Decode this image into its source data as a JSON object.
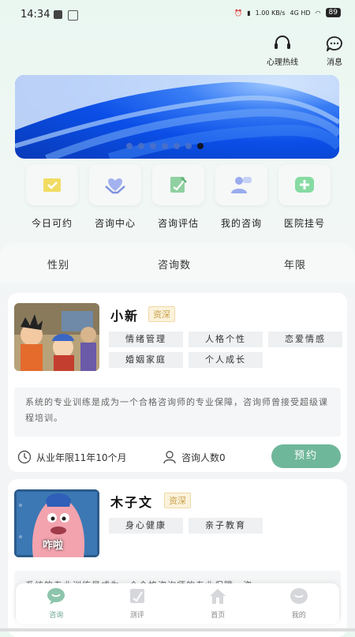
{
  "status": {
    "time": "14:34",
    "speed": "1.00\nKB/s",
    "network": "4G HD",
    "battery": "89"
  },
  "header": {
    "hotline_label": "心理热线",
    "message_label": "消息"
  },
  "banner": {
    "dots": 7,
    "active_dot": 6
  },
  "menu": [
    {
      "label": "今日可约",
      "icon": "calendar-check-icon",
      "color": "#e9d24a"
    },
    {
      "label": "咨询中心",
      "icon": "heart-hands-icon",
      "color": "#8fa2e6"
    },
    {
      "label": "咨询评估",
      "icon": "edit-doc-icon",
      "color": "#7cc58f"
    },
    {
      "label": "我的咨询",
      "icon": "user-chat-icon",
      "color": "#8fa2e6"
    },
    {
      "label": "医院挂号",
      "icon": "medical-cross-icon",
      "color": "#79d69a"
    }
  ],
  "filter": {
    "gender": "性别",
    "count": "咨询数",
    "years": "年限"
  },
  "counselors": [
    {
      "name": "小新",
      "badge": "资深",
      "tags": [
        "情绪管理",
        "人格个性",
        "恋爱情感",
        "婚姻家庭",
        "个人成长"
      ],
      "desc": "系统的专业训练是成为一个合格咨询师的专业保障，咨询师曾接受超级课程培训。",
      "experience": "从业年限11年10个月",
      "consult_count": "咨询人数0",
      "book_label": "预约"
    },
    {
      "name": "木子文",
      "badge": "资深",
      "tags": [
        "身心健康",
        "亲子教育"
      ],
      "desc": "系统的专业训练是成为一个合格咨询师的专业保障，咨",
      "avatar_caption": "咋啦"
    }
  ],
  "nav": [
    {
      "label": "咨询",
      "icon": "chat-bubble-icon",
      "active": true
    },
    {
      "label": "测评",
      "icon": "test-icon",
      "active": false
    },
    {
      "label": "首页",
      "icon": "home-icon",
      "active": false
    },
    {
      "label": "我的",
      "icon": "profile-icon",
      "active": false
    }
  ],
  "colors": {
    "accent": "#6fb79b",
    "badge": "#c9a04a"
  }
}
